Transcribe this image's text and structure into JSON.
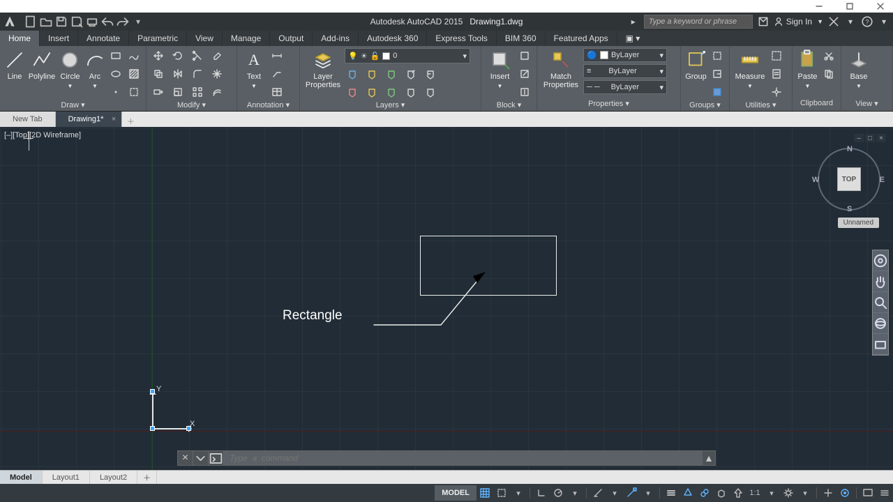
{
  "title": {
    "app": "Autodesk AutoCAD 2015",
    "file": "Drawing1.dwg"
  },
  "search_placeholder": "Type a keyword or phrase",
  "signin": "Sign In",
  "tabs": [
    "Home",
    "Insert",
    "Annotate",
    "Parametric",
    "View",
    "Manage",
    "Output",
    "Add-ins",
    "Autodesk 360",
    "Express Tools",
    "BIM 360",
    "Featured Apps"
  ],
  "active_tab": "Home",
  "panels": {
    "draw": {
      "title": "Draw",
      "items": [
        "Line",
        "Polyline",
        "Circle",
        "Arc"
      ]
    },
    "modify": {
      "title": "Modify"
    },
    "annot": {
      "title": "Annotation",
      "text": "Text"
    },
    "layers": {
      "title": "Layers",
      "layerprops": "Layer\nProperties",
      "current": "0"
    },
    "block": {
      "title": "Block",
      "insert": "Insert"
    },
    "props": {
      "title": "Properties",
      "match": "Match\nProperties",
      "bylayer": "ByLayer"
    },
    "groups": {
      "title": "Groups",
      "group": "Group"
    },
    "util": {
      "title": "Utilities",
      "measure": "Measure"
    },
    "clip": {
      "title": "Clipboard",
      "paste": "Paste"
    },
    "view": {
      "title": "View",
      "base": "Base"
    }
  },
  "filetabs": {
    "items": [
      "New Tab",
      "Drawing1*"
    ],
    "active": 1
  },
  "viewport_label": "[–][Top][2D Wireframe]",
  "annotation_text": "Rectangle",
  "ucs": {
    "x": "X",
    "y": "Y"
  },
  "viewcube": {
    "face": "TOP",
    "n": "N",
    "s": "S",
    "e": "E",
    "w": "W",
    "wcs": "Unnamed"
  },
  "cmd_placeholder": "Type  a  command",
  "layout_tabs": [
    "Model",
    "Layout1",
    "Layout2"
  ],
  "status": {
    "model": "MODEL",
    "scale": "1:1"
  }
}
